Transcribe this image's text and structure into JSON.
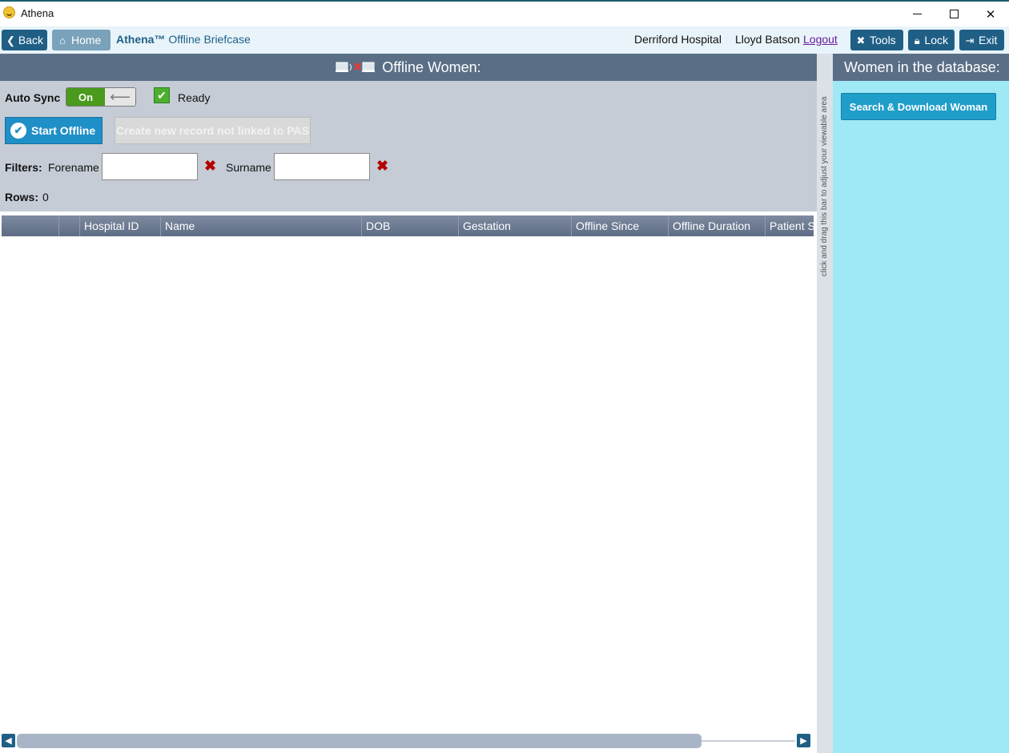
{
  "window": {
    "title": "Athena"
  },
  "nav": {
    "back_label": "Back",
    "home_label": "Home",
    "brand_name": "Athena™",
    "brand_section": "Offline Briefcase",
    "hospital": "Derriford Hospital",
    "user": "Lloyd Batson",
    "logout_label": "Logout",
    "tools_label": "Tools",
    "lock_label": "Lock",
    "exit_label": "Exit"
  },
  "left": {
    "title": "Offline Women:",
    "autosync_label": "Auto Sync",
    "autosync_state": "On",
    "status": "Ready",
    "start_offline_label": "Start Offline",
    "create_record_label": "Create new record not linked to PAS",
    "filters_label": "Filters:",
    "forename_label": "Forename",
    "forename_value": "",
    "surname_label": "Surname",
    "surname_value": "",
    "rows_label": "Rows:",
    "rows_count": "0",
    "columns": [
      "",
      "",
      "Hospital ID",
      "Name",
      "DOB",
      "Gestation",
      "Offline Since",
      "Offline Duration",
      "Patient S"
    ]
  },
  "splitter": {
    "hint": "click and drag this bar to adjust your viewable area"
  },
  "right": {
    "title": "Women in the database:",
    "search_download_label": "Search & Download Woman"
  },
  "colors": {
    "accent": "#1f5f86",
    "panel_header": "#5a6f86",
    "right_bg": "#9fe8f5",
    "toggle_on": "#4a9a1c"
  }
}
